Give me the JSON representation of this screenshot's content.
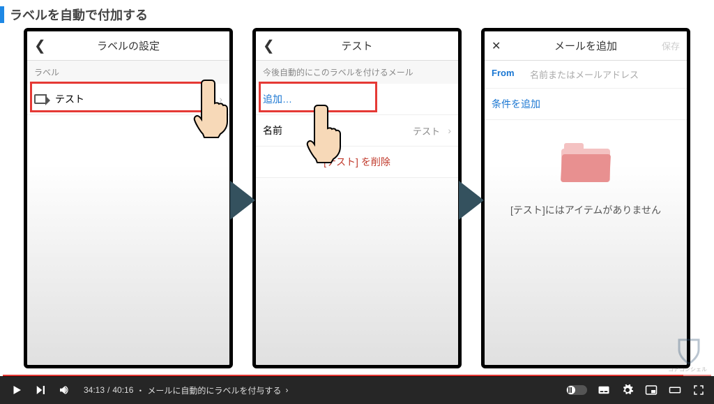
{
  "page": {
    "title": "ラベルを自動で付加する"
  },
  "screen1": {
    "header": "ラベルの設定",
    "section": "ラベル",
    "item": "テスト"
  },
  "screen2": {
    "header": "テスト",
    "section": "今後自動的にこのラベルを付けるメール",
    "add": "追加…",
    "name_label": "名前",
    "name_value": "テスト",
    "delete": "[テスト] を削除"
  },
  "screen3": {
    "header": "メールを追加",
    "save": "保存",
    "from_label": "From",
    "from_placeholder": "名前またはメールアドレス",
    "add_condition": "条件を追加",
    "empty": "[テスト]にはアイテムがありません"
  },
  "player": {
    "current": "34:13",
    "total": "40:16",
    "chapter": "メールに自動的にラベルを付与する"
  },
  "watermark": "コアコンシェル"
}
